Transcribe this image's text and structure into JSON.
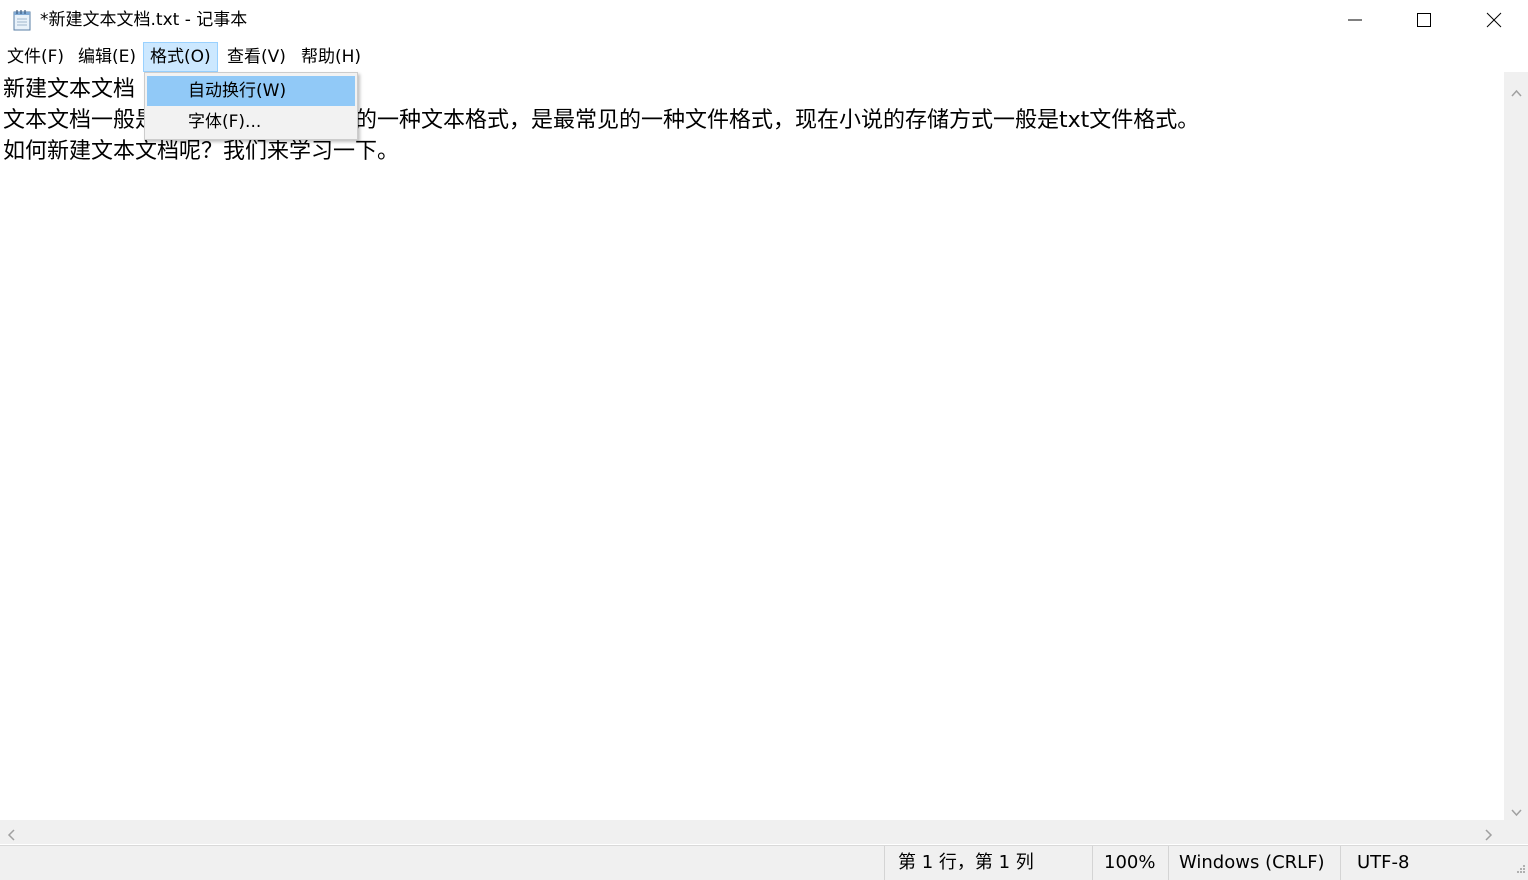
{
  "window": {
    "title": "*新建文本文档.txt - 记事本",
    "app_icon": "notepad-icon",
    "controls": [
      "minimize-icon",
      "maximize-icon",
      "close-icon"
    ]
  },
  "menubar": {
    "items": [
      {
        "label": "文件(F)"
      },
      {
        "label": "编辑(E)"
      },
      {
        "label": "格式(O)",
        "active": true
      },
      {
        "label": "查看(V)"
      },
      {
        "label": "帮助(H)"
      }
    ]
  },
  "format_menu": {
    "items": [
      {
        "label": "自动换行(W)",
        "highlighted": true
      },
      {
        "label": "字体(F)..."
      }
    ]
  },
  "editor": {
    "lines": [
      "新建文本文档",
      "文本文档一般是指在操作系统上附带的一种文本格式，是最常见的一种文件格式，现在小说的存储方式一般是txt文件格式。",
      "如何新建文本文档呢？我们来学习一下。"
    ]
  },
  "statusbar": {
    "position": "第 1 行，第 1 列",
    "zoom": "100%",
    "line_ending": "Windows (CRLF)",
    "encoding": "UTF-8"
  },
  "colors": {
    "menu_active_bg": "#cce8ff",
    "dropdown_highlight": "#91c9f7",
    "chrome_gray": "#f0f0f0"
  }
}
